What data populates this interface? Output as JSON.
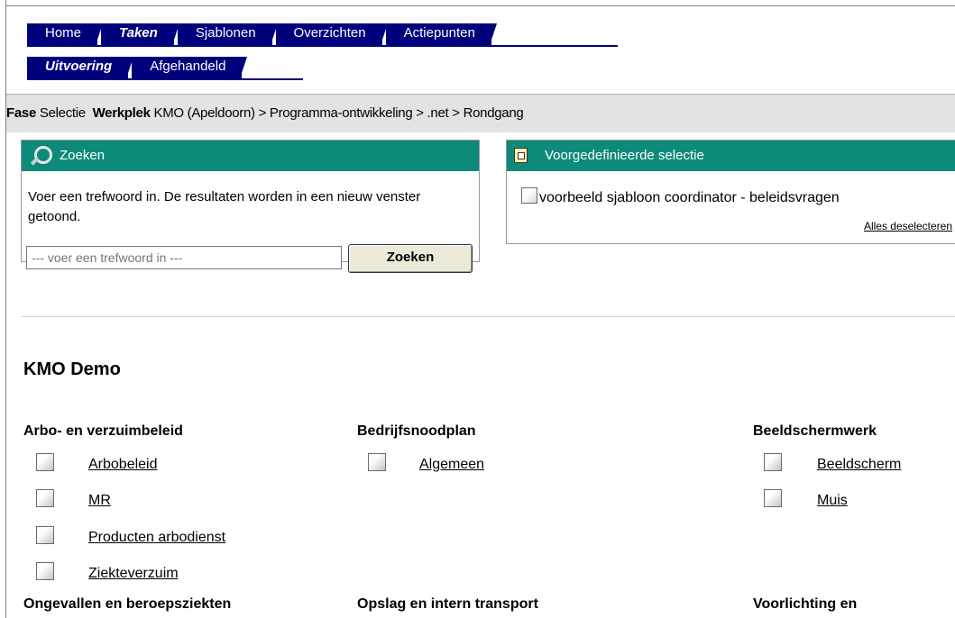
{
  "tabs": {
    "row1": [
      "Home",
      "Taken",
      "Sjablonen",
      "Overzichten",
      "Actiepunten"
    ],
    "row2": [
      "Uitvoering",
      "Afgehandeld"
    ]
  },
  "breadcrumb": {
    "fase_label": "Fase",
    "fase_value": "Selectie",
    "werkplek_label": "Werkplek",
    "path": "KMO (Apeldoorn) > Programma-ontwikkeling > .net > Rondgang"
  },
  "search": {
    "title": "Zoeken",
    "description": "Voer een trefwoord in. De resultaten worden in een nieuw venster getoond.",
    "placeholder": "--- voer een trefwoord in ---",
    "button": "Zoeken"
  },
  "predefined": {
    "title": "Voorgedefinieerde selectie",
    "item": "voorbeeld sjabloon coordinator - beleidsvragen",
    "deselect": "Alles deselecteren"
  },
  "main": {
    "section_title": "KMO Demo",
    "categories": [
      {
        "title": "Arbo- en verzuimbeleid",
        "items": [
          "Arbobeleid",
          "MR",
          "Producten arbodienst",
          "Ziekteverzuim"
        ]
      },
      {
        "title": "Bedrijfsnoodplan",
        "items": [
          "Algemeen"
        ]
      },
      {
        "title": "Beeldschermwerk",
        "items": [
          "Beeldscherm",
          "Muis"
        ]
      },
      {
        "title": "Ongevallen en beroepsziekten",
        "items": []
      },
      {
        "title": "Opslag en intern transport",
        "items": []
      },
      {
        "title": "Voorlichting en",
        "items": []
      }
    ]
  }
}
